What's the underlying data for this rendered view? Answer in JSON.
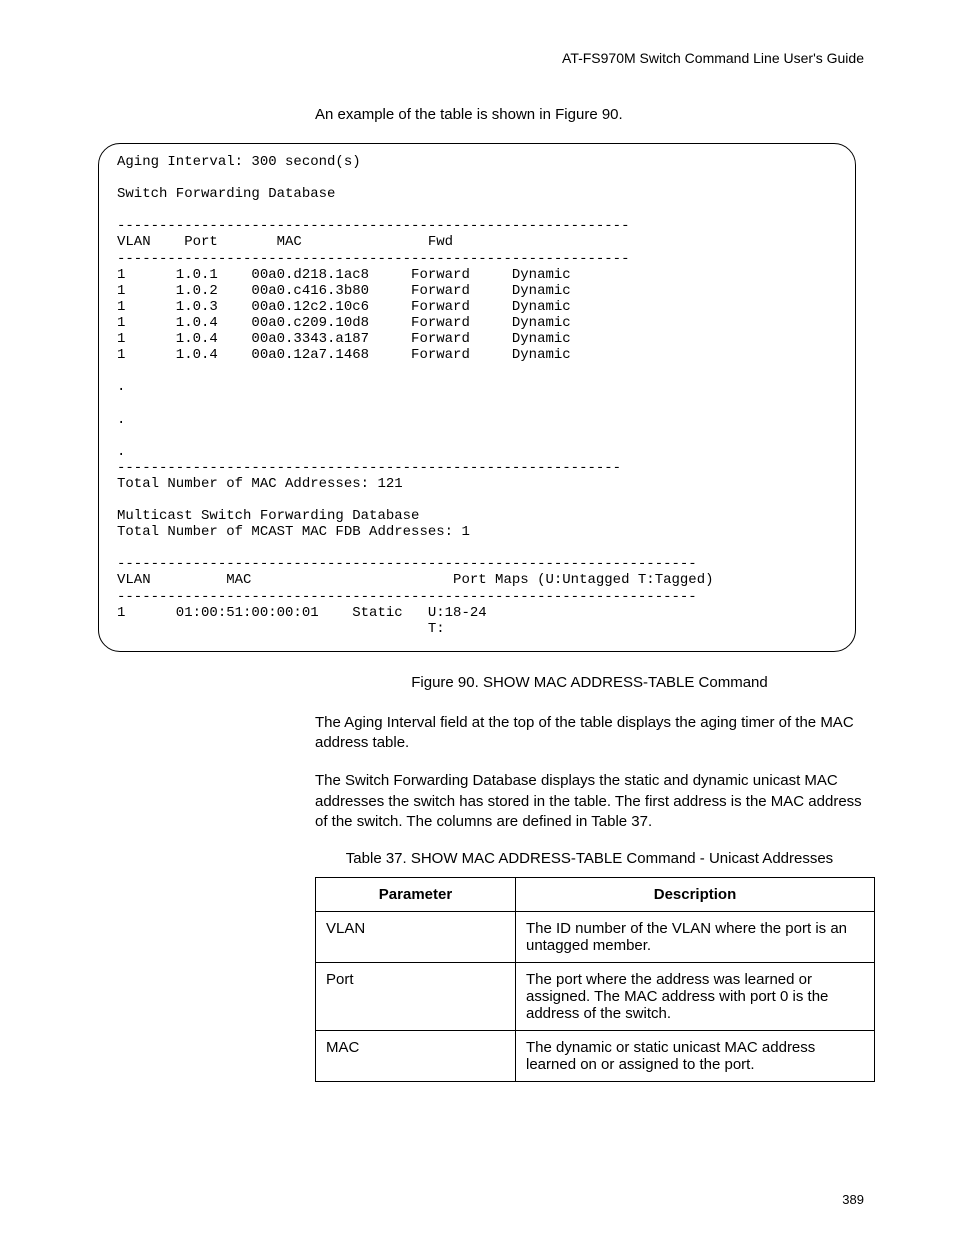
{
  "header": {
    "guide_title": "AT-FS970M Switch Command Line User's Guide"
  },
  "intro": "An example of the table is shown in Figure 90.",
  "terminal": {
    "aging_line": "Aging Interval: 300 second(s)",
    "sfd_title": "Switch Forwarding Database",
    "divider1": "-------------------------------------------------------------",
    "header_unicast": "VLAN    Port       MAC               Fwd",
    "divider2": "-------------------------------------------------------------",
    "rows": [
      "1      1.0.1    00a0.d218.1ac8     Forward     Dynamic",
      "1      1.0.2    00a0.c416.3b80     Forward     Dynamic",
      "1      1.0.3    00a0.12c2.10c6     Forward     Dynamic",
      "1      1.0.4    00a0.c209.10d8     Forward     Dynamic",
      "1      1.0.4    00a0.3343.a187     Forward     Dynamic",
      "1      1.0.4    00a0.12a7.1468     Forward     Dynamic"
    ],
    "ellipsis": ".\n\n.\n\n.",
    "divider3": "------------------------------------------------------------",
    "total_mac": "Total Number of MAC Addresses: 121",
    "msfd_title": "Multicast Switch Forwarding Database",
    "mcast_total": "Total Number of MCAST MAC FDB Addresses: 1",
    "divider4": "---------------------------------------------------------------------",
    "header_mcast": "VLAN         MAC                        Port Maps (U:Untagged T:Tagged)",
    "divider5": "---------------------------------------------------------------------",
    "mcast_row1": "1      01:00:51:00:00:01    Static   U:18-24",
    "mcast_row2": "                                     T:"
  },
  "figure_caption": "Figure 90. SHOW MAC ADDRESS-TABLE Command",
  "para1": "The Aging Interval field at the top of the table displays the aging timer of the MAC address table.",
  "para2": "The Switch Forwarding Database displays the static and dynamic unicast MAC addresses the switch has stored in the table. The first address is the MAC address of the switch. The columns are defined in Table 37.",
  "table_caption": "Table 37. SHOW MAC ADDRESS-TABLE Command - Unicast Addresses",
  "table": {
    "head": {
      "param": "Parameter",
      "desc": "Description"
    },
    "rows": [
      {
        "param": "VLAN",
        "desc": "The ID number of the VLAN where the port is an untagged member."
      },
      {
        "param": "Port",
        "desc": "The port where the address was learned or assigned. The MAC address with port 0 is the address of the switch."
      },
      {
        "param": "MAC",
        "desc": "The dynamic or static unicast MAC address learned on or assigned to the port."
      }
    ]
  },
  "page_number": "389"
}
